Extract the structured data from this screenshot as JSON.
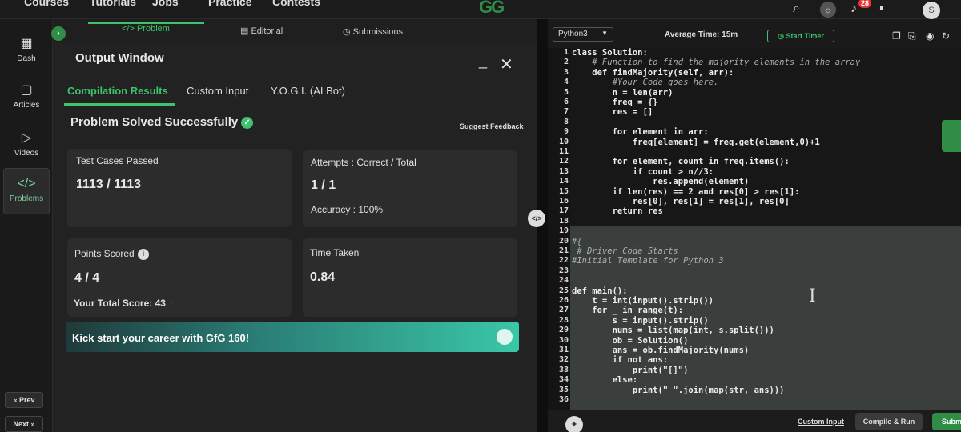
{
  "topbar": {
    "nav": [
      "Courses",
      "Tutorials",
      "Jobs",
      "Practice",
      "Contests"
    ],
    "logo": "GG",
    "notification_count": "28",
    "avatar_letter": "S"
  },
  "sidebar": {
    "items": [
      {
        "label": "Dash",
        "icon": "dashboard-icon",
        "glyph": "▦"
      },
      {
        "label": "Articles",
        "icon": "book-icon",
        "glyph": "▢"
      },
      {
        "label": "Videos",
        "icon": "play-icon",
        "glyph": "▷"
      },
      {
        "label": "Problems",
        "icon": "code-icon",
        "glyph": "</>"
      }
    ],
    "prev_label": "« Prev",
    "next_label": "Next »"
  },
  "problem_tabs": [
    {
      "label": "</> Problem",
      "active": true
    },
    {
      "label": "Editorial",
      "active": false
    },
    {
      "label": "Submissions",
      "active": false
    }
  ],
  "output_window": {
    "title": "Output Window",
    "tabs": [
      "Compilation Results",
      "Custom Input",
      "Y.O.G.I. (AI Bot)"
    ],
    "status": "Problem Solved Successfully",
    "suggest_feedback": "Suggest Feedback",
    "test_cases_label": "Test Cases Passed",
    "test_cases_value": "1113 / 1113",
    "attempts_label": "Attempts : Correct / Total",
    "attempts_value": "1 / 1",
    "accuracy": "Accuracy : 100%",
    "points_label": "Points Scored",
    "points_value": "4 / 4",
    "total_score": "Your Total Score: 43",
    "time_label": "Time Taken",
    "time_value": "0.84",
    "banner_text": "Kick start your career with GfG 160!"
  },
  "editor_header": {
    "language": "Python3",
    "average_time": "Average Time: 15m",
    "start_timer": "Start Timer"
  },
  "code_lines": [
    {
      "n": "1",
      "text": "class Solution:"
    },
    {
      "n": "2",
      "text": "    # Function to find the majority elements in the array"
    },
    {
      "n": "3",
      "text": "    def findMajority(self, arr):"
    },
    {
      "n": "4",
      "text": "        #Your Code goes here."
    },
    {
      "n": "5",
      "text": "        n = len(arr)"
    },
    {
      "n": "6",
      "text": "        freq = {}"
    },
    {
      "n": "7",
      "text": "        res = []"
    },
    {
      "n": "8",
      "text": ""
    },
    {
      "n": "9",
      "text": "        for element in arr:"
    },
    {
      "n": "10",
      "text": "            freq[element] = freq.get(element,0)+1"
    },
    {
      "n": "11",
      "text": ""
    },
    {
      "n": "12",
      "text": "        for element, count in freq.items():"
    },
    {
      "n": "13",
      "text": "            if count > n//3:"
    },
    {
      "n": "14",
      "text": "                res.append(element)"
    },
    {
      "n": "15",
      "text": "        if len(res) == 2 and res[0] > res[1]:"
    },
    {
      "n": "16",
      "text": "            res[0], res[1] = res[1], res[0]"
    },
    {
      "n": "17",
      "text": "        return res"
    },
    {
      "n": "18",
      "text": ""
    },
    {
      "n": "19",
      "text": ""
    },
    {
      "n": "20",
      "text": "#{"
    },
    {
      "n": "21",
      "text": " # Driver Code Starts"
    },
    {
      "n": "22",
      "text": "#Initial Template for Python 3"
    },
    {
      "n": "23",
      "text": ""
    },
    {
      "n": "24",
      "text": ""
    },
    {
      "n": "25",
      "text": "def main():"
    },
    {
      "n": "26",
      "text": "    t = int(input().strip())"
    },
    {
      "n": "27",
      "text": "    for _ in range(t):"
    },
    {
      "n": "28",
      "text": "        s = input().strip()"
    },
    {
      "n": "29",
      "text": "        nums = list(map(int, s.split()))"
    },
    {
      "n": "30",
      "text": "        ob = Solution()"
    },
    {
      "n": "31",
      "text": "        ans = ob.findMajority(nums)"
    },
    {
      "n": "32",
      "text": "        if not ans:"
    },
    {
      "n": "33",
      "text": "            print(\"[]\")"
    },
    {
      "n": "34",
      "text": "        else:"
    },
    {
      "n": "35",
      "text": "            print(\" \".join(map(str, ans)))"
    },
    {
      "n": "36",
      "text": ""
    }
  ],
  "footer": {
    "custom_input": "Custom Input",
    "compile_run": "Compile & Run",
    "submit": "Submit"
  }
}
